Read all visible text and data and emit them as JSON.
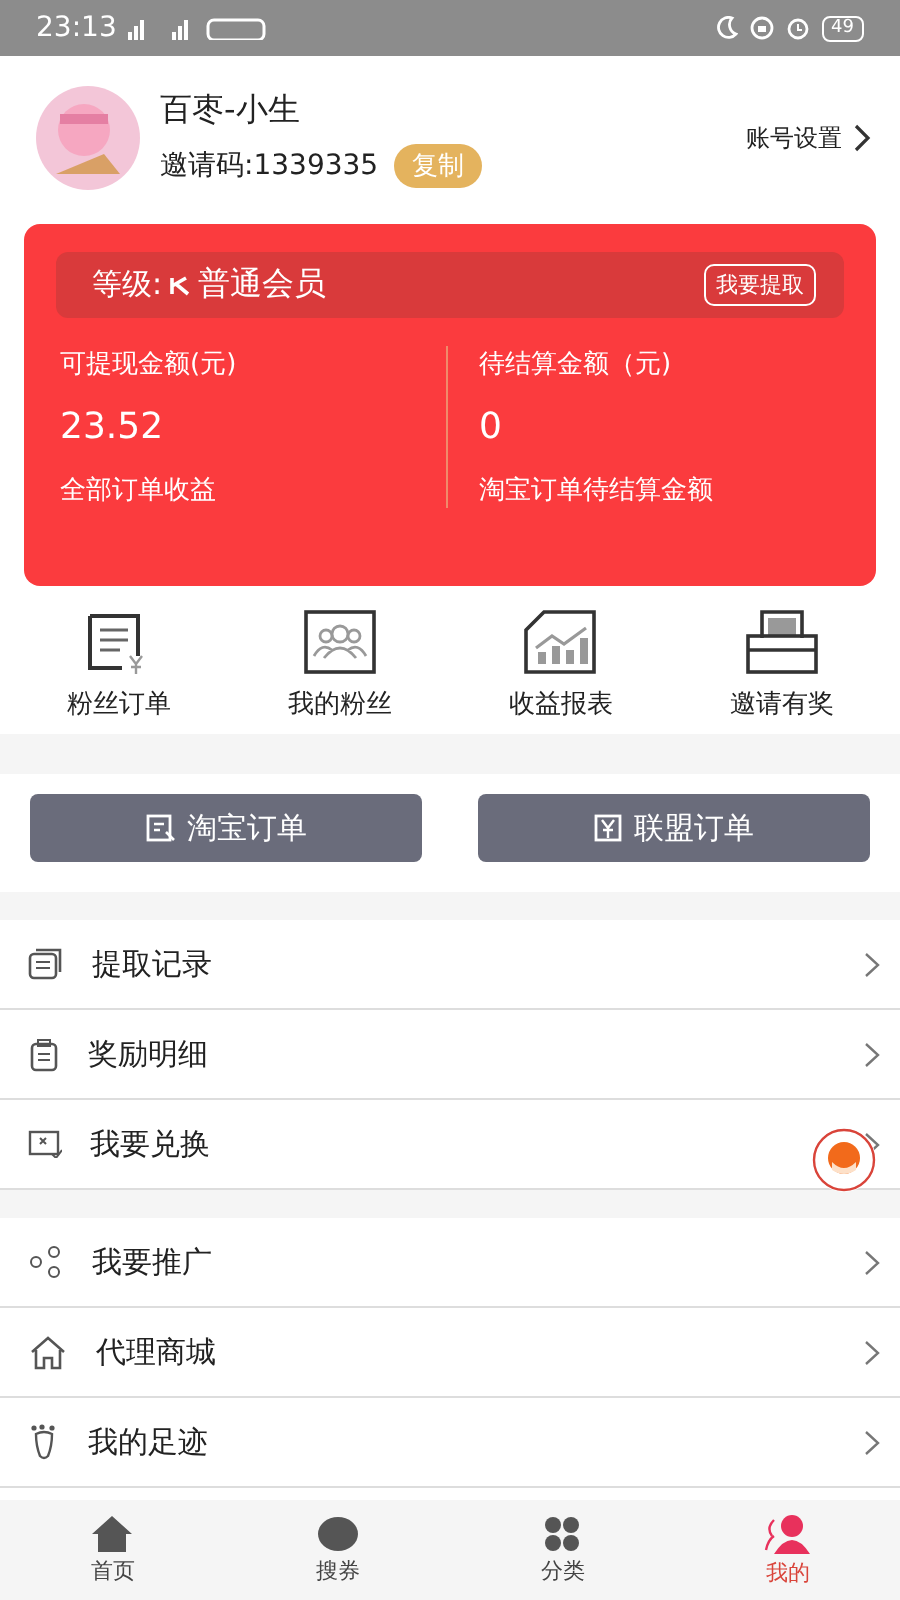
{
  "status_bar": {
    "time": "23:13",
    "battery": "49"
  },
  "profile": {
    "name": "百枣-小生",
    "invite_code": "邀请码:1339335",
    "copy_button": "复制",
    "settings_link": "账号设置"
  },
  "earnings_card": {
    "level_label": "等级:",
    "level_value": "普通会员",
    "withdraw_button": "我要提取",
    "columns": [
      {
        "title": "可提现金额(元)",
        "amount": "23.52",
        "caption": "全部订单收益"
      },
      {
        "title": "待结算金额（元)",
        "amount": "0",
        "caption": "淘宝订单待结算金额"
      }
    ]
  },
  "shortcuts": [
    {
      "label": "粉丝订单"
    },
    {
      "label": "我的粉丝"
    },
    {
      "label": "收益报表"
    },
    {
      "label": "邀请有奖"
    }
  ],
  "order_buttons": [
    {
      "label": "淘宝订单"
    },
    {
      "label": "联盟订单"
    }
  ],
  "menu_groups": [
    {
      "items": [
        {
          "label": "提取记录"
        },
        {
          "label": "奖励明细"
        },
        {
          "label": "我要兑换"
        }
      ]
    },
    {
      "items": [
        {
          "label": "我要推广"
        },
        {
          "label": "代理商城"
        },
        {
          "label": "我的足迹"
        }
      ]
    }
  ],
  "tab_bar": [
    {
      "label": "首页",
      "selected": false
    },
    {
      "label": "搜券",
      "selected": false
    },
    {
      "label": "分类",
      "selected": false
    },
    {
      "label": "我的",
      "selected": true
    }
  ]
}
